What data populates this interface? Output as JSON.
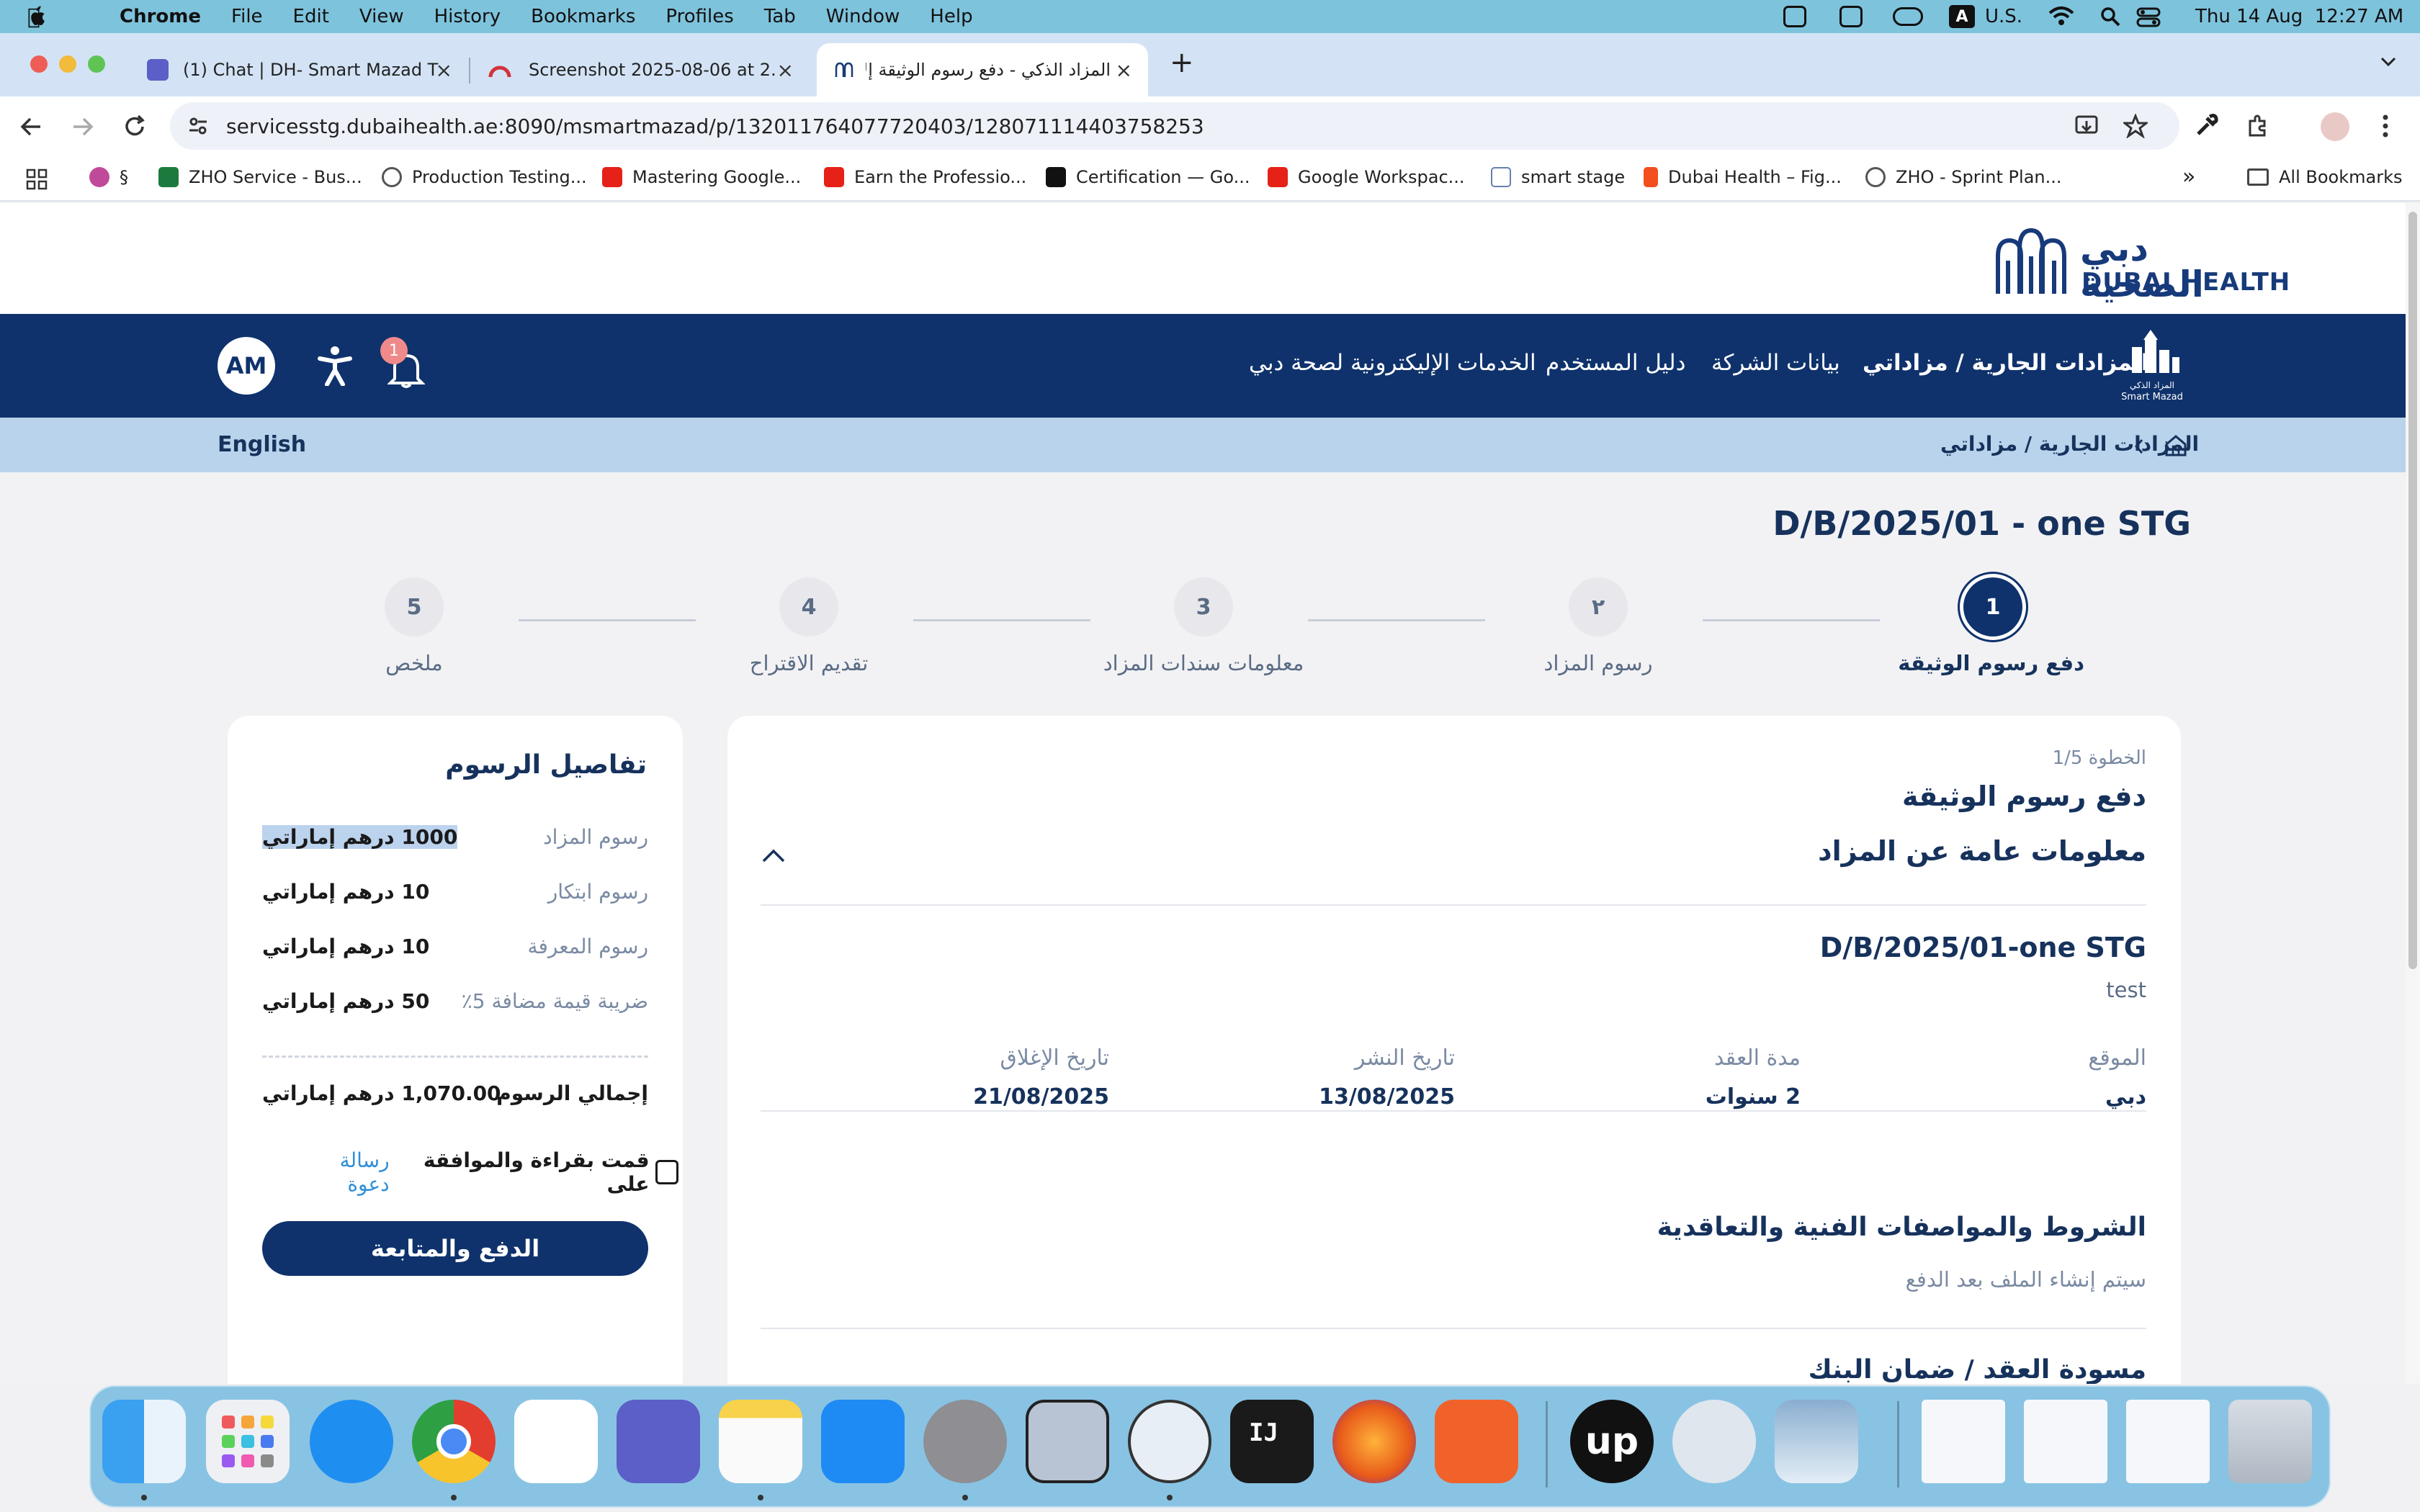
{
  "menubar": {
    "app": "Chrome",
    "items": [
      "File",
      "Edit",
      "View",
      "History",
      "Bookmarks",
      "Profiles",
      "Tab",
      "Window",
      "Help"
    ],
    "input_source": "U.S.",
    "input_badge": "A",
    "datetime": "Thu 14 Aug  12:27 AM"
  },
  "tabs": [
    {
      "title": "(1) Chat | DH- Smart Mazad T"
    },
    {
      "title": "Screenshot 2025-08-06 at 2."
    },
    {
      "title": "المزاد الذكي - دفع رسوم الوثيقة إلا"
    }
  ],
  "address": {
    "url": "servicesstg.dubaihealth.ae:8090/msmartmazad/p/132011764077720403/128071114403758253"
  },
  "bookmarks": [
    {
      "label": "§"
    },
    {
      "label": "ZHO Service - Bus..."
    },
    {
      "label": "Production Testing..."
    },
    {
      "label": "Mastering Google..."
    },
    {
      "label": "Earn the Professio..."
    },
    {
      "label": "Certification — Go..."
    },
    {
      "label": "Google Workspac..."
    },
    {
      "label": "smart stage"
    },
    {
      "label": "Dubai Health – Fig..."
    },
    {
      "label": "ZHO - Sprint Plan..."
    }
  ],
  "all_bookmarks": "All Bookmarks",
  "site": {
    "logo_ar": "دبي الصحية",
    "logo_en": "DUBAI HEALTH",
    "smart_mazad_ar": "المزاد الذكي",
    "smart_mazad_en": "Smart Mazad",
    "nav": [
      "المزادات الجارية / مزاداتي",
      "بيانات الشركة",
      "دليل المستخدم",
      "الخدمات الإليكترونية لصحة دبي"
    ],
    "notification_count": "1",
    "avatar": "AM",
    "language": "English",
    "breadcrumb": "المزادات الجارية / مزاداتي"
  },
  "auction_title": "D/B/2025/01 - one STG",
  "steps": [
    {
      "num": "1",
      "label": "دفع رسوم الوثيقة"
    },
    {
      "num": "٢",
      "label": "رسوم المزاد"
    },
    {
      "num": "3",
      "label": "معلومات سندات المزاد"
    },
    {
      "num": "4",
      "label": "تقديم الاقتراح"
    },
    {
      "num": "5",
      "label": "ملخص"
    }
  ],
  "fees": {
    "title": "تفاصيل الرسوم",
    "rows": [
      {
        "label": "رسوم المزاد",
        "value": "1000 درهم إماراتي"
      },
      {
        "label": "رسوم ابتكار",
        "value": "10 درهم إماراتي"
      },
      {
        "label": "رسوم المعرفة",
        "value": "10 درهم إماراتي"
      },
      {
        "label": "ضريبة قيمة مضافة 5٪",
        "value": "50 درهم إماراتي"
      }
    ],
    "total_label": "إجمالي الرسوم",
    "total_value": "1,070.00 درهم إماراتي",
    "agree_text": "قمت بقراءة والموافقة على",
    "agree_link": "رسالة دعوة",
    "pay_button": "الدفع والمتابعة"
  },
  "details": {
    "step_counter": "الخطوة 1/5",
    "step_title": "دفع رسوم الوثيقة",
    "section_title": "معلومات عامة عن المزاد",
    "auction_name": "D/B/2025/01-one STG",
    "auction_desc": "test",
    "fields": [
      {
        "label": "الموقع",
        "value": "دبي"
      },
      {
        "label": "مدة العقد",
        "value": "2 سنوات"
      },
      {
        "label": "تاريخ النشر",
        "value": "13/08/2025"
      },
      {
        "label": "تاريخ الإغلاق",
        "value": "21/08/2025"
      }
    ],
    "terms_title": "الشروط والمواصفات الفنية والتعاقدية",
    "terms_note": "سيتم إنشاء الملف بعد الدفع",
    "draft_title": "مسودة العقد / ضمان البنك"
  },
  "colors": {
    "navy": "#0f326c",
    "crumb_bg": "#b9d3ec",
    "link": "#2f8fd6",
    "menubar": "#7ec3dc"
  }
}
